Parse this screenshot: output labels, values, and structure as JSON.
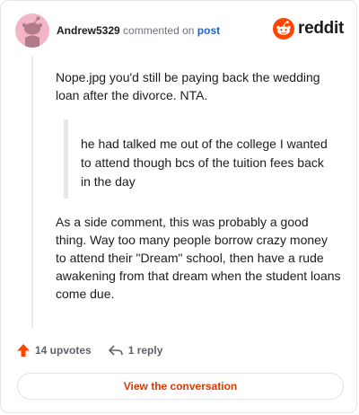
{
  "header": {
    "username": "Andrew5329",
    "action_text": "commented on",
    "post_link": "post",
    "brand": "reddit"
  },
  "comment": {
    "paragraph1": "Nope.jpg you'd still be paying back the wedding loan after the divorce. NTA.",
    "quote": "he had talked me out of the college I wanted to attend though bcs of the tuition fees back in the day",
    "paragraph2": "As a side comment, this was probably a good thing. Way too many people borrow crazy money to attend their \"Dream\" school, then have a rude awakening from that dream when the student loans come due."
  },
  "actions": {
    "upvotes": "14 upvotes",
    "replies": "1 reply"
  },
  "cta": {
    "label": "View the conversation"
  },
  "icons": {
    "avatar": "snoo-avatar-icon",
    "brand": "reddit-logo-icon",
    "upvote": "upvote-arrow-icon",
    "reply": "reply-arrow-icon"
  },
  "colors": {
    "accent": "#d93a00",
    "upvote": "#ff4500",
    "link": "#1a66c9",
    "avatar_bg": "#f3b6c6"
  }
}
